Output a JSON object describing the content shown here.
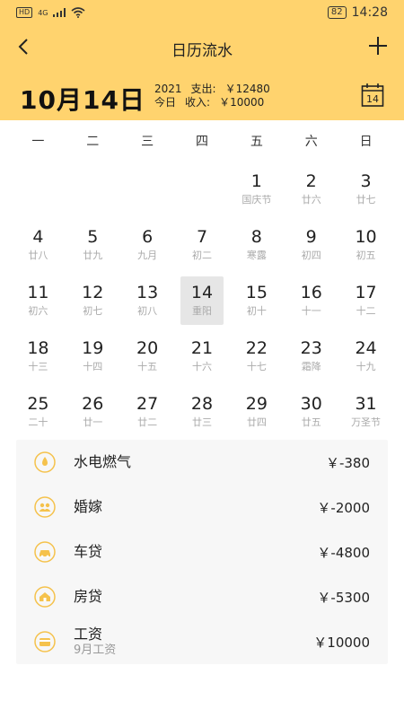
{
  "status_bar": {
    "hd": "HD",
    "network": "4G",
    "battery": "82",
    "time": "14:28"
  },
  "header": {
    "title": "日历流水"
  },
  "summary": {
    "date": "10月14日",
    "year": "2021",
    "today": "今日",
    "expense_label": "支出:",
    "expense_value": "￥12480",
    "income_label": "收入:",
    "income_value": "￥10000",
    "calendar_icon_day": "14"
  },
  "weekdays": [
    "一",
    "二",
    "三",
    "四",
    "五",
    "六",
    "日"
  ],
  "calendar": {
    "leading_empty": 4,
    "selected_day": 14,
    "days": [
      {
        "d": "1",
        "l": "国庆节"
      },
      {
        "d": "2",
        "l": "廿六"
      },
      {
        "d": "3",
        "l": "廿七"
      },
      {
        "d": "4",
        "l": "廿八"
      },
      {
        "d": "5",
        "l": "廿九"
      },
      {
        "d": "6",
        "l": "九月"
      },
      {
        "d": "7",
        "l": "初二"
      },
      {
        "d": "8",
        "l": "寒露"
      },
      {
        "d": "9",
        "l": "初四"
      },
      {
        "d": "10",
        "l": "初五"
      },
      {
        "d": "11",
        "l": "初六"
      },
      {
        "d": "12",
        "l": "初七"
      },
      {
        "d": "13",
        "l": "初八"
      },
      {
        "d": "14",
        "l": "重阳"
      },
      {
        "d": "15",
        "l": "初十"
      },
      {
        "d": "16",
        "l": "十一"
      },
      {
        "d": "17",
        "l": "十二"
      },
      {
        "d": "18",
        "l": "十三"
      },
      {
        "d": "19",
        "l": "十四"
      },
      {
        "d": "20",
        "l": "十五"
      },
      {
        "d": "21",
        "l": "十六"
      },
      {
        "d": "22",
        "l": "十七"
      },
      {
        "d": "23",
        "l": "霜降"
      },
      {
        "d": "24",
        "l": "十九"
      },
      {
        "d": "25",
        "l": "二十"
      },
      {
        "d": "26",
        "l": "廿一"
      },
      {
        "d": "27",
        "l": "廿二"
      },
      {
        "d": "28",
        "l": "廿三"
      },
      {
        "d": "29",
        "l": "廿四"
      },
      {
        "d": "30",
        "l": "廿五"
      },
      {
        "d": "31",
        "l": "万圣节"
      }
    ]
  },
  "transactions": [
    {
      "icon": "utilities-icon",
      "name": "水电燃气",
      "sub": "",
      "amount": "￥-380"
    },
    {
      "icon": "wedding-icon",
      "name": "婚嫁",
      "sub": "",
      "amount": "￥-2000"
    },
    {
      "icon": "car-loan-icon",
      "name": "车贷",
      "sub": "",
      "amount": "￥-4800"
    },
    {
      "icon": "house-loan-icon",
      "name": "房贷",
      "sub": "",
      "amount": "￥-5300"
    },
    {
      "icon": "salary-icon",
      "name": "工资",
      "sub": "9月工资",
      "amount": "￥10000"
    }
  ],
  "colors": {
    "accent": "#FFD36E",
    "icon": "#F5C24C",
    "selected_bg": "#E6E6E6",
    "list_bg": "#F7F7F7"
  }
}
